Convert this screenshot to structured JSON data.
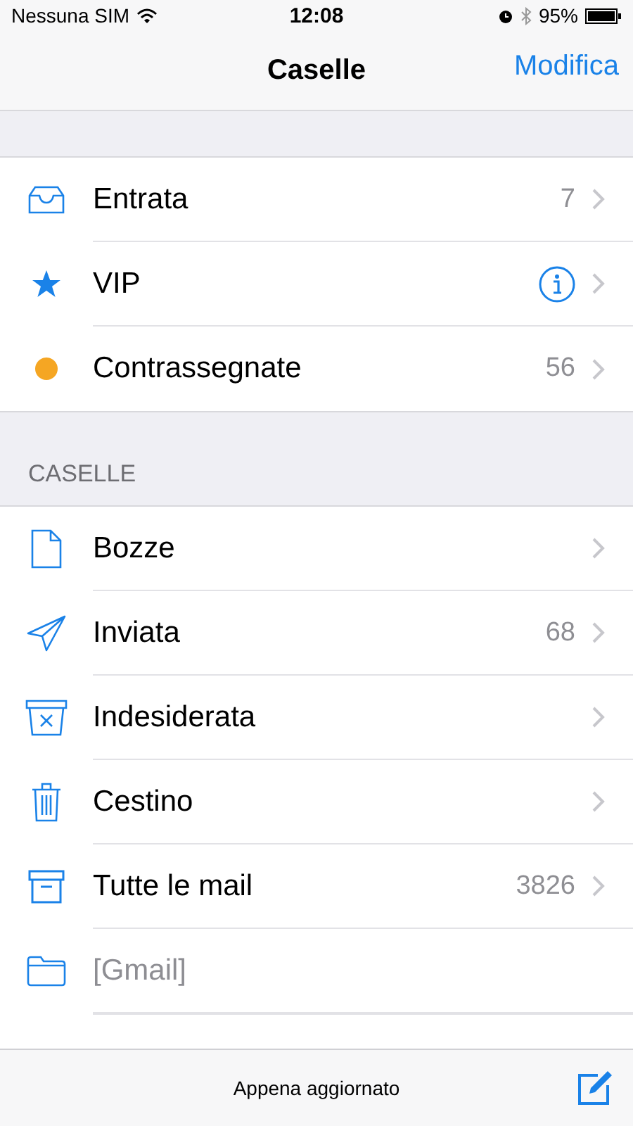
{
  "status_bar": {
    "carrier": "Nessuna SIM",
    "time": "12:08",
    "battery": "95%"
  },
  "nav": {
    "title": "Caselle",
    "action": "Modifica"
  },
  "favorites": [
    {
      "kind": "inbox",
      "label": "Entrata",
      "count": "7",
      "info": false
    },
    {
      "kind": "star",
      "label": "VIP",
      "info": true
    },
    {
      "kind": "dot",
      "label": "Contrassegnate",
      "count": "56",
      "info": false,
      "color": "#f5a623"
    }
  ],
  "section_header": "CASELLE",
  "mailboxes": [
    {
      "kind": "draft",
      "label": "Bozze",
      "disabled": false
    },
    {
      "kind": "sent",
      "label": "Inviata",
      "count": "68",
      "disabled": false
    },
    {
      "kind": "junk",
      "label": "Indesiderata",
      "disabled": false
    },
    {
      "kind": "trash",
      "label": "Cestino",
      "disabled": false
    },
    {
      "kind": "archive",
      "label": "Tutte le mail",
      "count": "3826",
      "disabled": false
    },
    {
      "kind": "folder",
      "label": "[Gmail]",
      "disabled": true
    }
  ],
  "toolbar": {
    "status": "Appena aggiornato"
  }
}
